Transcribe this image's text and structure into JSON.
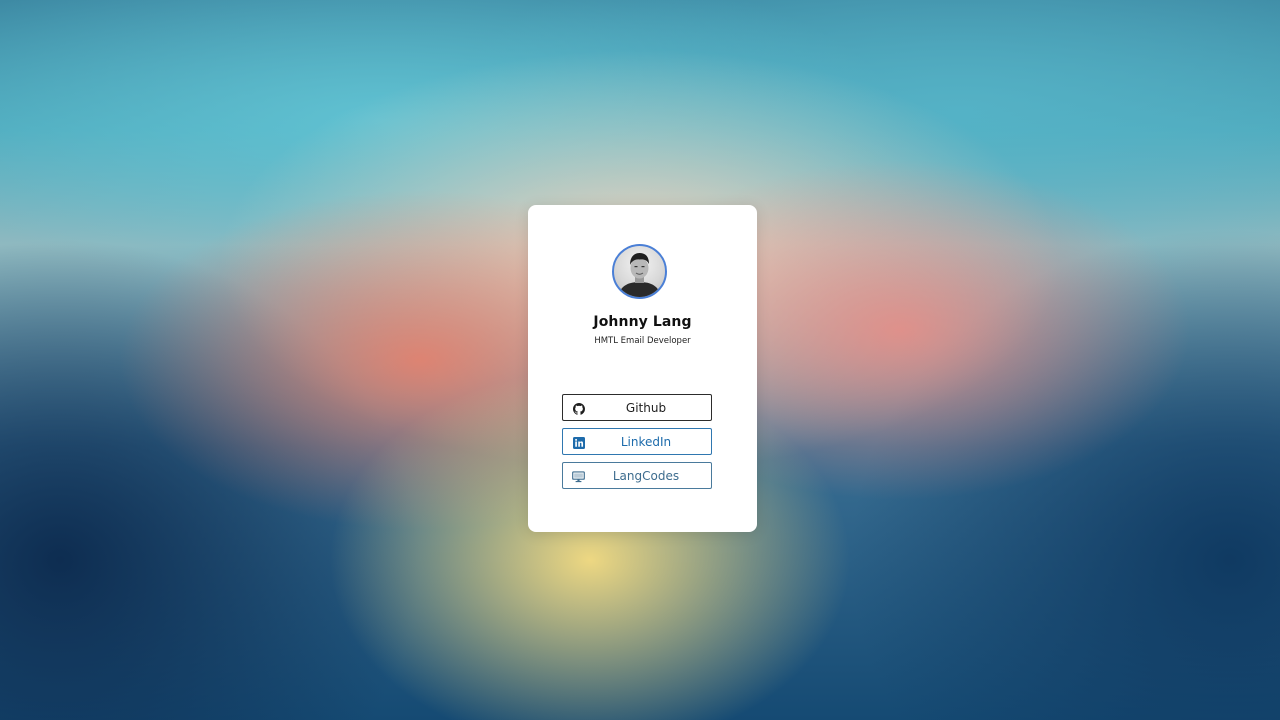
{
  "profile": {
    "name": "Johnny Lang",
    "role": "HMTL Email Developer",
    "avatar_icon": "profile-photo"
  },
  "links": [
    {
      "label": "Github",
      "icon": "github-icon",
      "color": "#1e1e1e"
    },
    {
      "label": "LinkedIn",
      "icon": "linkedin-icon",
      "color": "#1d6bab"
    },
    {
      "label": "LangCodes",
      "icon": "monitor-icon",
      "color": "#3d6c8e"
    }
  ],
  "colors": {
    "card_background": "#ffffff",
    "avatar_ring": "#4a7fd6"
  }
}
